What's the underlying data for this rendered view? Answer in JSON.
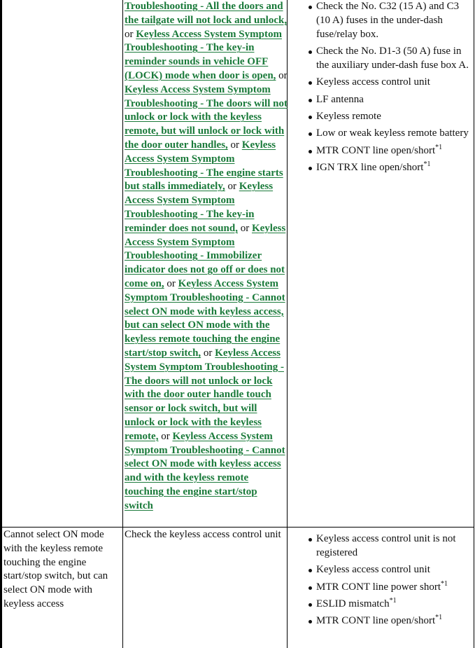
{
  "row1": {
    "links": [
      {
        "text": "Troubleshooting - All the doors and the tailgate will not lock and unlock,"
      },
      {
        "text": "Keyless Access System Symptom Troubleshooting - The key-in reminder sounds in vehicle OFF (LOCK) mode when door is open,"
      },
      {
        "text": "Keyless Access System Symptom Troubleshooting - The doors will not unlock or lock with the keyless remote, but will unlock or lock with the door outer handles,"
      },
      {
        "text": "Keyless Access System Symptom Troubleshooting - The engine starts but stalls immediately,"
      },
      {
        "text": "Keyless Access System Symptom Troubleshooting - The key-in reminder does not sound,"
      },
      {
        "text": "Keyless Access System Symptom Troubleshooting - Immobilizer indicator does not go off or does not come on,"
      },
      {
        "text": "Keyless Access System Symptom Troubleshooting - Cannot select ON mode with keyless access, but can select ON mode with the keyless remote touching the engine start/stop switch,"
      },
      {
        "text": "Keyless Access System Symptom Troubleshooting - The doors will not unlock or lock with the door outer handle touch sensor or lock switch, but will unlock or lock with the keyless remote,"
      },
      {
        "text": "Keyless Access System Symptom Troubleshooting - Cannot select ON mode with keyless access and with the keyless remote touching the engine start/stop switch"
      }
    ],
    "separator": "or",
    "causes": [
      {
        "text": "Check the No. C32 (15 A) and C3 (10 A) fuses in the under-dash fuse/relay box.",
        "sup": ""
      },
      {
        "text": "Check the No. D1-3 (50 A) fuse in the auxiliary under-dash fuse box A.",
        "sup": ""
      },
      {
        "text": "Keyless access control unit",
        "sup": ""
      },
      {
        "text": "LF antenna",
        "sup": ""
      },
      {
        "text": "Keyless remote",
        "sup": ""
      },
      {
        "text": "Low or weak keyless remote battery",
        "sup": ""
      },
      {
        "text": "MTR CONT line open/short",
        "sup": "*1"
      },
      {
        "text": "IGN TRX line open/short",
        "sup": "*1"
      }
    ]
  },
  "row2": {
    "symptom": "Cannot select ON mode with the keyless remote touching the engine start/stop switch, but can select ON mode with keyless access",
    "procedure": "Check the keyless access control unit",
    "causes": [
      {
        "text": "Keyless access control unit is not registered",
        "sup": ""
      },
      {
        "text": "Keyless access control unit",
        "sup": ""
      },
      {
        "text": "MTR CONT line power short",
        "sup": "*1"
      },
      {
        "text": "ESLID mismatch",
        "sup": "*1"
      },
      {
        "text": "MTR CONT line open/short",
        "sup": "*1"
      }
    ]
  },
  "colors": {
    "link": "#1a7a3a"
  }
}
